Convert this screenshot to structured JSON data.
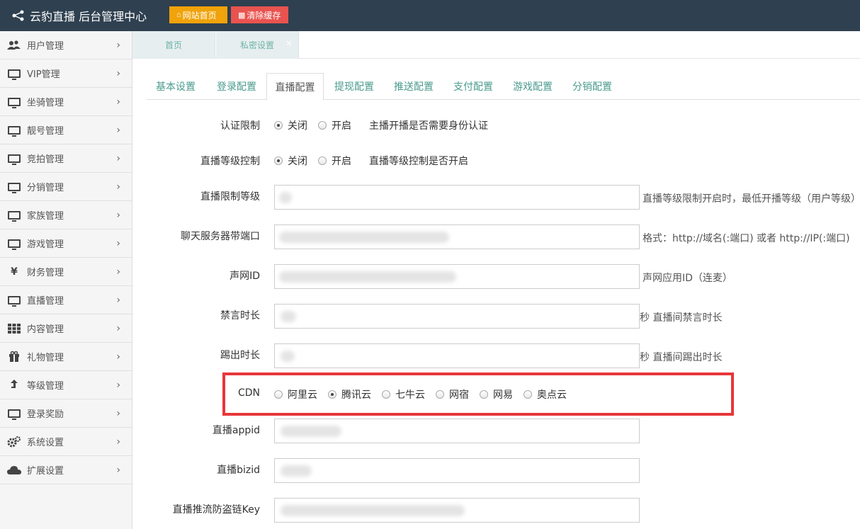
{
  "header": {
    "title": "云豹直播 后台管理中心",
    "btn_home": "网站首页",
    "btn_cache": "清除缓存"
  },
  "sidebar": {
    "items": [
      {
        "label": "用户管理",
        "icon": "users-icon"
      },
      {
        "label": "VIP管理",
        "icon": "monitor-icon"
      },
      {
        "label": "坐骑管理",
        "icon": "monitor-icon"
      },
      {
        "label": "靓号管理",
        "icon": "monitor-icon"
      },
      {
        "label": "竞拍管理",
        "icon": "monitor-icon"
      },
      {
        "label": "分销管理",
        "icon": "monitor-icon"
      },
      {
        "label": "家族管理",
        "icon": "monitor-icon"
      },
      {
        "label": "游戏管理",
        "icon": "monitor-icon"
      },
      {
        "label": "财务管理",
        "icon": "yen-icon"
      },
      {
        "label": "直播管理",
        "icon": "monitor-icon"
      },
      {
        "label": "内容管理",
        "icon": "grid-icon"
      },
      {
        "label": "礼物管理",
        "icon": "gift-icon"
      },
      {
        "label": "等级管理",
        "icon": "level-up-icon"
      },
      {
        "label": "登录奖励",
        "icon": "monitor-icon"
      },
      {
        "label": "系统设置",
        "icon": "gears-icon"
      },
      {
        "label": "扩展设置",
        "icon": "cloud-icon"
      }
    ]
  },
  "pagetabs": {
    "home": "首页",
    "private": "私密设置",
    "close": "×"
  },
  "subtabs": [
    "基本设置",
    "登录配置",
    "直播配置",
    "提现配置",
    "推送配置",
    "支付配置",
    "游戏配置",
    "分销配置"
  ],
  "form": {
    "auth": {
      "label": "认证限制",
      "off": "关闭",
      "on": "开启",
      "help": "主播开播是否需要身份认证"
    },
    "level_ctrl": {
      "label": "直播等级控制",
      "off": "关闭",
      "on": "开启",
      "help": "直播等级控制是否开启"
    },
    "level_limit": {
      "label": "直播限制等级",
      "help": "直播等级限制开启时，最低开播等级（用户等级）"
    },
    "chat_port": {
      "label": "聊天服务器带端口",
      "help": "格式：http://域名(:端口) 或者 http://IP(:端口)"
    },
    "agora_id": {
      "label": "声网ID",
      "help": "声网应用ID（连麦）"
    },
    "mute_time": {
      "label": "禁言时长",
      "help": "秒 直播间禁言时长"
    },
    "kick_time": {
      "label": "踢出时长",
      "help": "秒 直播间踢出时长"
    },
    "cdn": {
      "label": "CDN",
      "options": [
        "阿里云",
        "腾讯云",
        "七牛云",
        "网宿",
        "网易",
        "奥点云"
      ],
      "selected": "腾讯云"
    },
    "appid": {
      "label": "直播appid"
    },
    "bizid": {
      "label": "直播bizid"
    },
    "push_key": {
      "label": "直播推流防盗链Key"
    }
  },
  "colors": {
    "topbar": "#2f4050",
    "home_button": "#f0a30a",
    "cache_button": "#e9534f",
    "highlight_box": "#e8363a",
    "tab_text": "#4a9b8e"
  }
}
